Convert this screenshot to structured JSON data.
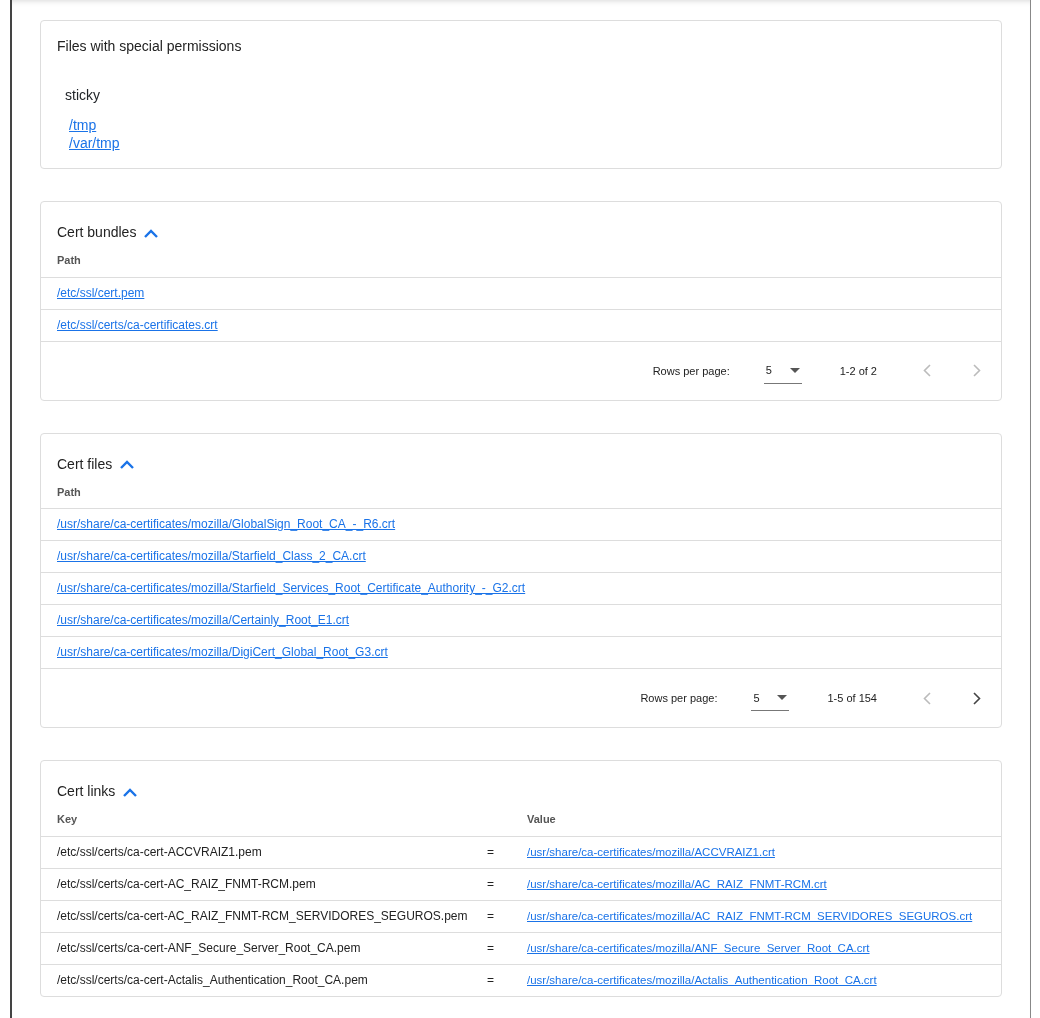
{
  "special_permissions": {
    "title": "Files with special permissions",
    "groups": [
      {
        "label": "sticky",
        "files": [
          "/tmp",
          "/var/tmp"
        ]
      }
    ]
  },
  "sections": [
    {
      "kind": "list",
      "title": "Cert bundles",
      "expanded": true,
      "columns": [
        "Path"
      ],
      "rows": [
        [
          "/etc/ssl/cert.pem"
        ],
        [
          "/etc/ssl/certs/ca-certificates.crt"
        ]
      ],
      "pagination": {
        "rows_per_page_label": "Rows per page:",
        "rows_per_page": "5",
        "range": "1-2 of 2",
        "prev_disabled": true,
        "next_disabled": true
      }
    },
    {
      "kind": "list",
      "title": "Cert files",
      "expanded": true,
      "columns": [
        "Path"
      ],
      "rows": [
        [
          "/usr/share/ca-certificates/mozilla/GlobalSign_Root_CA_-_R6.crt"
        ],
        [
          "/usr/share/ca-certificates/mozilla/Starfield_Class_2_CA.crt"
        ],
        [
          "/usr/share/ca-certificates/mozilla/Starfield_Services_Root_Certificate_Authority_-_G2.crt"
        ],
        [
          "/usr/share/ca-certificates/mozilla/Certainly_Root_E1.crt"
        ],
        [
          "/usr/share/ca-certificates/mozilla/DigiCert_Global_Root_G3.crt"
        ]
      ],
      "pagination": {
        "rows_per_page_label": "Rows per page:",
        "rows_per_page": "5",
        "range": "1-5 of 154",
        "prev_disabled": true,
        "next_disabled": false
      }
    },
    {
      "kind": "links",
      "title": "Cert links",
      "expanded": true,
      "columns": [
        "Key",
        "",
        "Value"
      ],
      "rows": [
        [
          "/etc/ssl/certs/ca-cert-ACCVRAIZ1.pem",
          "=",
          "/usr/share/ca-certificates/mozilla/ACCVRAIZ1.crt"
        ],
        [
          "/etc/ssl/certs/ca-cert-AC_RAIZ_FNMT-RCM.pem",
          "=",
          "/usr/share/ca-certificates/mozilla/AC_RAIZ_FNMT-RCM.crt"
        ],
        [
          "/etc/ssl/certs/ca-cert-AC_RAIZ_FNMT-RCM_SERVIDORES_SEGUROS.pem",
          "=",
          "/usr/share/ca-certificates/mozilla/AC_RAIZ_FNMT-RCM_SERVIDORES_SEGUROS.crt"
        ],
        [
          "/etc/ssl/certs/ca-cert-ANF_Secure_Server_Root_CA.pem",
          "=",
          "/usr/share/ca-certificates/mozilla/ANF_Secure_Server_Root_CA.crt"
        ],
        [
          "/etc/ssl/certs/ca-cert-Actalis_Authentication_Root_CA.pem",
          "=",
          "/usr/share/ca-certificates/mozilla/Actalis_Authentication_Root_CA.crt"
        ]
      ]
    }
  ]
}
